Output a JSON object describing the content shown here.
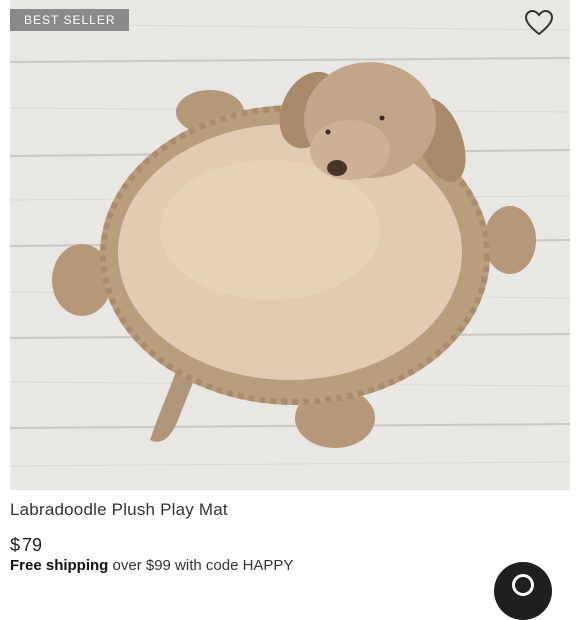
{
  "product": {
    "badge": "BEST SELLER",
    "title": "Labradoodle Plush Play Mat",
    "currency": "$",
    "price": "79",
    "shipping_bold": "Free shipping",
    "shipping_rest": " over $99 with code HAPPY"
  },
  "icons": {
    "favorite": "heart-icon",
    "chat": "chat-icon"
  },
  "colors": {
    "badge_bg": "#8a8a8a",
    "mat_fur": "#b99e7e",
    "mat_center": "#e2cbb0"
  }
}
